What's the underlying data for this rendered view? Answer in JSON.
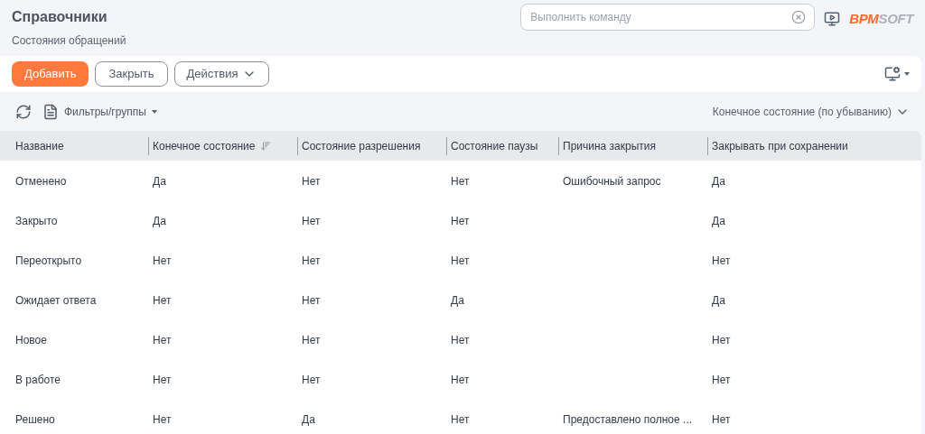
{
  "header": {
    "title": "Справочники",
    "subtitle": "Состояния обращений"
  },
  "command": {
    "placeholder": "Выполнить команду"
  },
  "logo": {
    "accent": "BPM",
    "rest": "SOFT"
  },
  "toolbar": {
    "buttons": [
      {
        "label": "Добавить",
        "kind": "primary"
      },
      {
        "label": "Закрыть",
        "kind": "outline"
      },
      {
        "label": "Действия",
        "kind": "dropdown"
      }
    ]
  },
  "filters": {
    "label": "Фильтры/группы",
    "sort": "Конечное состояние (по убыванию)"
  },
  "table": {
    "columns": [
      {
        "label": "Название",
        "sorted": false
      },
      {
        "label": "Конечное состояние",
        "sorted": true
      },
      {
        "label": "Состояние разрешения",
        "sorted": false
      },
      {
        "label": "Состояние паузы",
        "sorted": false
      },
      {
        "label": "Причина закрытия",
        "sorted": false
      },
      {
        "label": "Закрывать при сохранении",
        "sorted": false
      }
    ],
    "rows": [
      [
        "Отменено",
        "Да",
        "Нет",
        "Нет",
        "Ошибочный запрос",
        "Да"
      ],
      [
        "Закрыто",
        "Да",
        "Нет",
        "Нет",
        "",
        "Да"
      ],
      [
        "Переоткрыто",
        "Нет",
        "Нет",
        "Нет",
        "",
        "Нет"
      ],
      [
        "Ожидает ответа",
        "Нет",
        "Нет",
        "Да",
        "",
        "Да"
      ],
      [
        "Новое",
        "Нет",
        "Нет",
        "Нет",
        "",
        "Нет"
      ],
      [
        "В работе",
        "Нет",
        "Нет",
        "Нет",
        "",
        "Нет"
      ],
      [
        "Решено",
        "Нет",
        "Да",
        "Нет",
        "Предоставлено полное ...",
        "Нет"
      ]
    ]
  }
}
